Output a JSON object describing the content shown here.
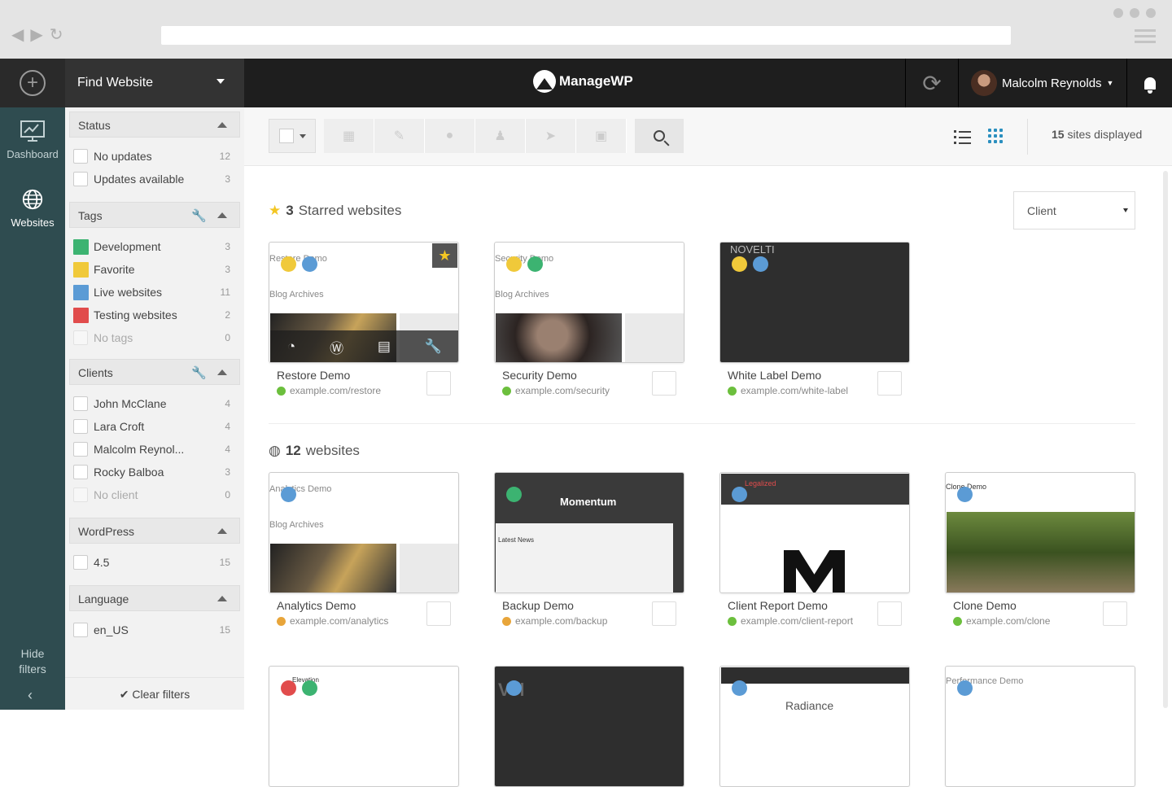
{
  "topbar": {
    "find_website_label": "Find Website",
    "logo_text": "ManageWP",
    "user_name": "Malcolm Reynolds"
  },
  "rail": {
    "dashboard_label": "Dashboard",
    "websites_label": "Websites",
    "hide_filters_line1": "Hide",
    "hide_filters_line2": "filters",
    "chevron": "‹"
  },
  "filters": {
    "status": {
      "title": "Status",
      "items": [
        {
          "label": "No updates",
          "count": "12"
        },
        {
          "label": "Updates available",
          "count": "3"
        }
      ]
    },
    "tags": {
      "title": "Tags",
      "items": [
        {
          "label": "Development",
          "count": "3",
          "color": "#3cb371"
        },
        {
          "label": "Favorite",
          "count": "3",
          "color": "#f0c93a"
        },
        {
          "label": "Live websites",
          "count": "11",
          "color": "#5b9bd5"
        },
        {
          "label": "Testing websites",
          "count": "2",
          "color": "#e14c4c"
        },
        {
          "label": "No tags",
          "count": "0"
        }
      ]
    },
    "clients": {
      "title": "Clients",
      "items": [
        {
          "label": "John McClane",
          "count": "4"
        },
        {
          "label": "Lara Croft",
          "count": "4"
        },
        {
          "label": "Malcolm Reynol...",
          "count": "4"
        },
        {
          "label": "Rocky Balboa",
          "count": "3"
        },
        {
          "label": "No client",
          "count": "0"
        }
      ]
    },
    "wordpress": {
      "title": "WordPress",
      "items": [
        {
          "label": "4.5",
          "count": "15"
        }
      ]
    },
    "language": {
      "title": "Language",
      "items": [
        {
          "label": "en_US",
          "count": "15"
        }
      ]
    },
    "clear_label": "Clear filters"
  },
  "toolbar": {
    "sites_count": "15",
    "sites_suffix": "sites displayed"
  },
  "starred": {
    "count": "3",
    "label": "Starred websites",
    "client_select": "Client"
  },
  "all": {
    "count": "12",
    "label": "websites"
  },
  "sites": [
    {
      "name": "Restore Demo",
      "url": "example.com/restore",
      "thumb_title": "Restore Demo",
      "thumb_sub": "Blog Archives"
    },
    {
      "name": "Security Demo",
      "url": "example.com/security",
      "thumb_title": "Security Demo",
      "thumb_sub": "Blog Archives"
    },
    {
      "name": "White Label Demo",
      "url": "example.com/white-label",
      "thumb_title": "NOVELTI"
    },
    {
      "name": "Analytics Demo",
      "url": "example.com/analytics",
      "thumb_title": "Analytics Demo",
      "thumb_sub": "Blog Archives"
    },
    {
      "name": "Backup Demo",
      "url": "example.com/backup",
      "thumb_title": "Momentum",
      "thumb_sub": "Latest News"
    },
    {
      "name": "Client Report Demo",
      "url": "example.com/client-report",
      "thumb_title": "Legalized"
    },
    {
      "name": "Clone Demo",
      "url": "example.com/clone",
      "thumb_title": "Clone Demo"
    },
    {
      "thumb_title": "Elevation"
    },
    {
      "thumb_title": "Vol"
    },
    {
      "thumb_title": "Radiance"
    },
    {
      "thumb_title": "Performance Demo"
    }
  ],
  "colors": {
    "accent": "#2a8fbf",
    "rail": "#2f4c50",
    "star": "#f3c623",
    "tag_green": "#3cb371",
    "tag_yellow": "#f0c93a",
    "tag_blue": "#5b9bd5",
    "tag_red": "#e14c4c"
  }
}
